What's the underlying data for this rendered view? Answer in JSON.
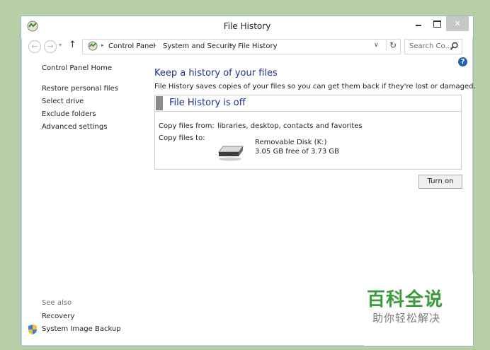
{
  "window": {
    "title": "File History",
    "close_glyph": "✕"
  },
  "navbar": {
    "back_glyph": "←",
    "forward_glyph": "→",
    "recent_glyph": "▾",
    "up_glyph": "↑",
    "breadcrumbs": [
      "Control Panel",
      "System and Security",
      "File History"
    ],
    "separator_glyph": "▸",
    "dropdown_glyph": "∨",
    "refresh_glyph": "↻",
    "search_placeholder": "Search Co..."
  },
  "sidebar": {
    "home": "Control Panel Home",
    "items": [
      "Restore personal files",
      "Select drive",
      "Exclude folders",
      "Advanced settings"
    ],
    "see_also_label": "See also",
    "see_also": [
      "Recovery",
      "System Image Backup"
    ]
  },
  "main": {
    "help_glyph": "?",
    "heading": "Keep a history of your files",
    "description": "File History saves copies of your files so you can get them back if they're lost or damaged.",
    "status": "File History is off",
    "copy_from_label": "Copy files from:",
    "copy_from_value": "libraries, desktop, contacts and favorites",
    "copy_to_label": "Copy files to:",
    "drive_name": "Removable Disk (K:)",
    "drive_free": "3.05 GB free of 3.73 GB",
    "turn_on_label": "Turn on"
  },
  "watermark": {
    "title": "百科全说",
    "subtitle": "助你轻松解决"
  },
  "colors": {
    "background": "#b7cfa6",
    "heading_blue": "#1e3287",
    "watermark_green": "#3a9b3a",
    "close_button": "#c7c7c7"
  }
}
